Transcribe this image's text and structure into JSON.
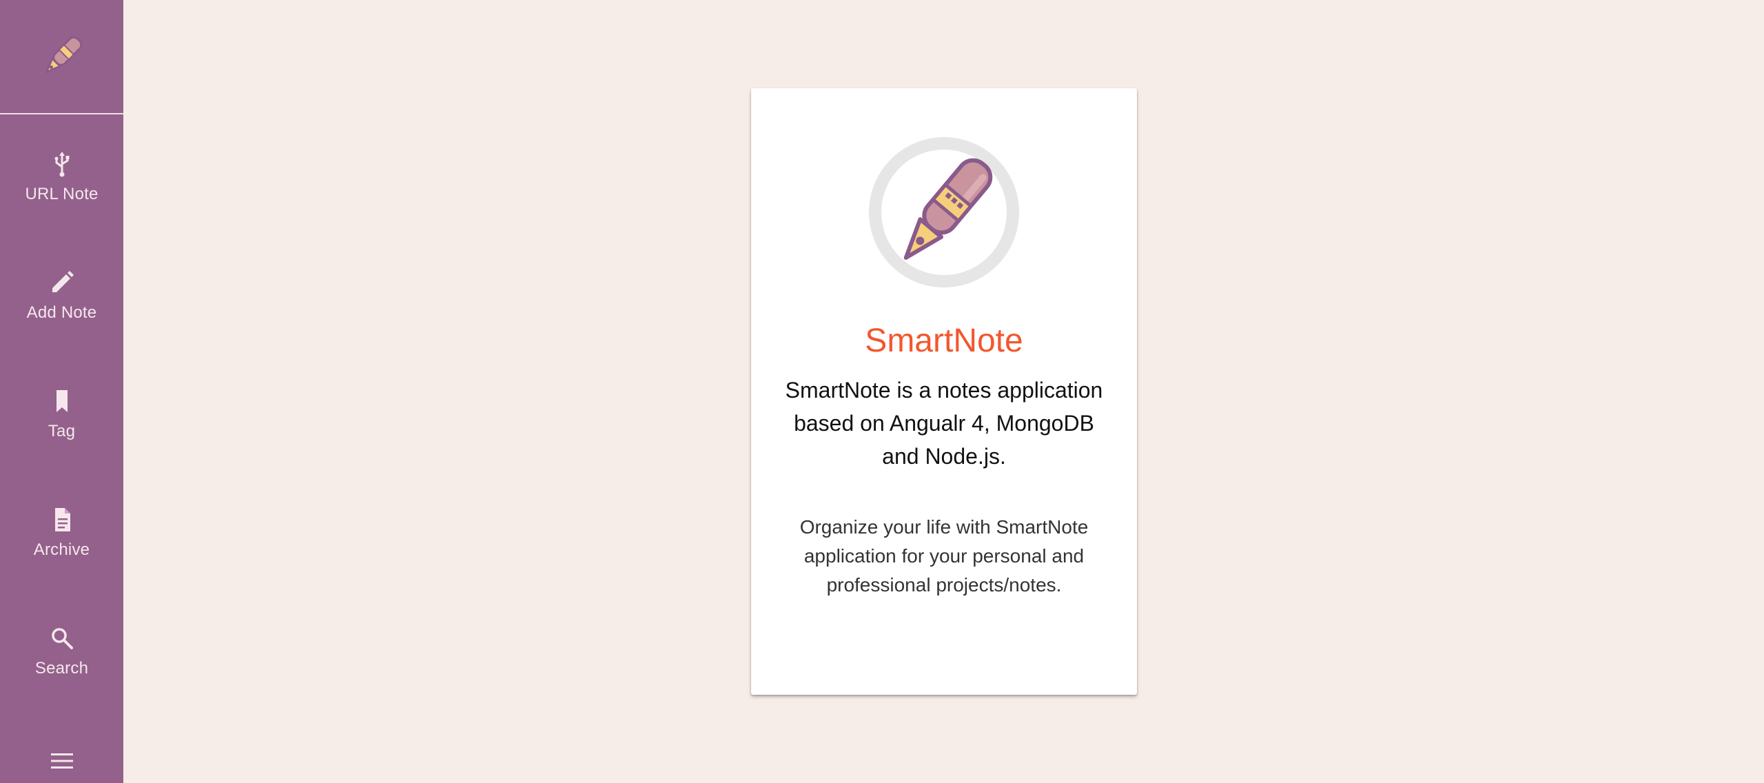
{
  "sidebar": {
    "logo_icon": "pen-logo-icon",
    "items": [
      {
        "label": "URL Note",
        "icon": "usb-icon"
      },
      {
        "label": "Add Note",
        "icon": "pencil-icon"
      },
      {
        "label": "Tag",
        "icon": "bookmark-icon"
      },
      {
        "label": "Archive",
        "icon": "document-icon"
      },
      {
        "label": "Search",
        "icon": "search-icon"
      }
    ],
    "menu_icon": "hamburger-menu-icon"
  },
  "card": {
    "title": "SmartNote",
    "description": "SmartNote is a notes application based on Angualr 4, MongoDB and Node.js.",
    "subtitle": "Organize your life with SmartNote application for your personal and professional projects/notes."
  },
  "colors": {
    "sidebar_bg": "#93618c",
    "page_bg": "#f6ece8",
    "title": "#f2572e",
    "pen_body": "#c9949d",
    "pen_band": "#f6cf7a",
    "pen_outline": "#8a5a8c"
  }
}
